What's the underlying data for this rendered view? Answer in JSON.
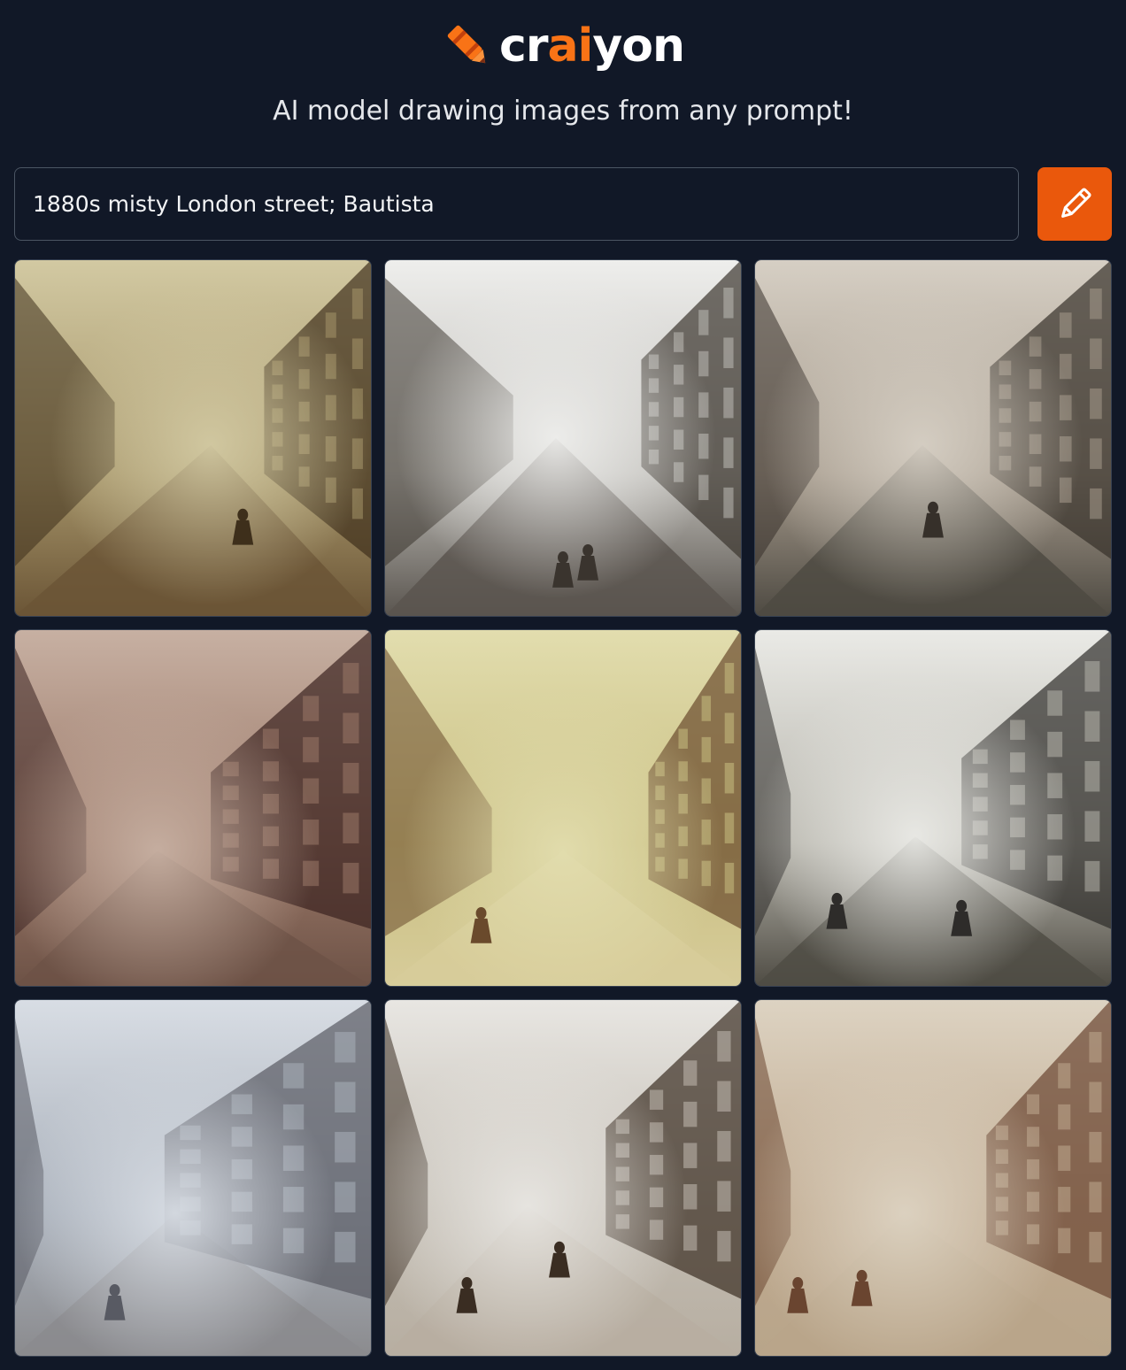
{
  "brand": {
    "name_prefix": "cr",
    "name_accent": "ai",
    "name_suffix": "yon",
    "accent_color": "#f97316",
    "logo_icon": "crayon-icon"
  },
  "tagline": "AI model drawing images from any prompt!",
  "prompt": {
    "value": "1880s misty London street; Bautista",
    "draw_button_icon": "pencil-icon",
    "button_color": "#ea580c"
  },
  "results": {
    "count": 9,
    "images": [
      {
        "palette": {
          "sky": "#d2c9a2",
          "mid": "#a6956a",
          "dark": "#3e2f1b",
          "ground": "#6b5536"
        }
      },
      {
        "palette": {
          "sky": "#eeeeec",
          "mid": "#bdbbb6",
          "dark": "#3a342e",
          "ground": "#5a554f"
        }
      },
      {
        "palette": {
          "sky": "#d6cfc4",
          "mid": "#a59a8c",
          "dark": "#36302a",
          "ground": "#4e4a42"
        }
      },
      {
        "palette": {
          "sky": "#c7b0a2",
          "mid": "#9a7868",
          "dark": "#3b2220",
          "ground": "#6d5246"
        }
      },
      {
        "palette": {
          "sky": "#e2ddae",
          "mid": "#c9bf82",
          "dark": "#6a4a2c",
          "ground": "#d7cc9a"
        }
      },
      {
        "palette": {
          "sky": "#eaeae6",
          "mid": "#b6b4ab",
          "dark": "#2e2c2a",
          "ground": "#4f4c44"
        }
      },
      {
        "palette": {
          "sky": "#d8dde4",
          "mid": "#a9b0ba",
          "dark": "#585a63",
          "ground": "#8b8b8e"
        }
      },
      {
        "palette": {
          "sky": "#e8e6e2",
          "mid": "#c2bcb2",
          "dark": "#3a2d22",
          "ground": "#b7aea1"
        }
      },
      {
        "palette": {
          "sky": "#ddd3c2",
          "mid": "#bfa98f",
          "dark": "#6a4530",
          "ground": "#b8a58a"
        }
      }
    ]
  }
}
